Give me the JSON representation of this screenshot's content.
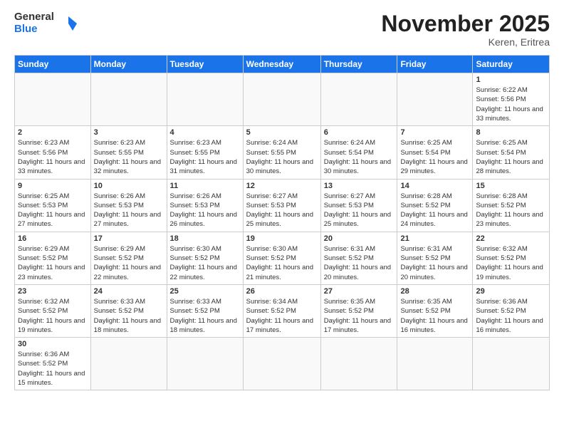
{
  "header": {
    "logo_general": "General",
    "logo_blue": "Blue",
    "month_title": "November 2025",
    "location": "Keren, Eritrea"
  },
  "days_of_week": [
    "Sunday",
    "Monday",
    "Tuesday",
    "Wednesday",
    "Thursday",
    "Friday",
    "Saturday"
  ],
  "weeks": [
    [
      {
        "day": "",
        "info": ""
      },
      {
        "day": "",
        "info": ""
      },
      {
        "day": "",
        "info": ""
      },
      {
        "day": "",
        "info": ""
      },
      {
        "day": "",
        "info": ""
      },
      {
        "day": "",
        "info": ""
      },
      {
        "day": "1",
        "info": "Sunrise: 6:22 AM\nSunset: 5:56 PM\nDaylight: 11 hours and 33 minutes."
      }
    ],
    [
      {
        "day": "2",
        "info": "Sunrise: 6:23 AM\nSunset: 5:56 PM\nDaylight: 11 hours and 33 minutes."
      },
      {
        "day": "3",
        "info": "Sunrise: 6:23 AM\nSunset: 5:55 PM\nDaylight: 11 hours and 32 minutes."
      },
      {
        "day": "4",
        "info": "Sunrise: 6:23 AM\nSunset: 5:55 PM\nDaylight: 11 hours and 31 minutes."
      },
      {
        "day": "5",
        "info": "Sunrise: 6:24 AM\nSunset: 5:55 PM\nDaylight: 11 hours and 30 minutes."
      },
      {
        "day": "6",
        "info": "Sunrise: 6:24 AM\nSunset: 5:54 PM\nDaylight: 11 hours and 30 minutes."
      },
      {
        "day": "7",
        "info": "Sunrise: 6:25 AM\nSunset: 5:54 PM\nDaylight: 11 hours and 29 minutes."
      },
      {
        "day": "8",
        "info": "Sunrise: 6:25 AM\nSunset: 5:54 PM\nDaylight: 11 hours and 28 minutes."
      }
    ],
    [
      {
        "day": "9",
        "info": "Sunrise: 6:25 AM\nSunset: 5:53 PM\nDaylight: 11 hours and 27 minutes."
      },
      {
        "day": "10",
        "info": "Sunrise: 6:26 AM\nSunset: 5:53 PM\nDaylight: 11 hours and 27 minutes."
      },
      {
        "day": "11",
        "info": "Sunrise: 6:26 AM\nSunset: 5:53 PM\nDaylight: 11 hours and 26 minutes."
      },
      {
        "day": "12",
        "info": "Sunrise: 6:27 AM\nSunset: 5:53 PM\nDaylight: 11 hours and 25 minutes."
      },
      {
        "day": "13",
        "info": "Sunrise: 6:27 AM\nSunset: 5:53 PM\nDaylight: 11 hours and 25 minutes."
      },
      {
        "day": "14",
        "info": "Sunrise: 6:28 AM\nSunset: 5:52 PM\nDaylight: 11 hours and 24 minutes."
      },
      {
        "day": "15",
        "info": "Sunrise: 6:28 AM\nSunset: 5:52 PM\nDaylight: 11 hours and 23 minutes."
      }
    ],
    [
      {
        "day": "16",
        "info": "Sunrise: 6:29 AM\nSunset: 5:52 PM\nDaylight: 11 hours and 23 minutes."
      },
      {
        "day": "17",
        "info": "Sunrise: 6:29 AM\nSunset: 5:52 PM\nDaylight: 11 hours and 22 minutes."
      },
      {
        "day": "18",
        "info": "Sunrise: 6:30 AM\nSunset: 5:52 PM\nDaylight: 11 hours and 22 minutes."
      },
      {
        "day": "19",
        "info": "Sunrise: 6:30 AM\nSunset: 5:52 PM\nDaylight: 11 hours and 21 minutes."
      },
      {
        "day": "20",
        "info": "Sunrise: 6:31 AM\nSunset: 5:52 PM\nDaylight: 11 hours and 20 minutes."
      },
      {
        "day": "21",
        "info": "Sunrise: 6:31 AM\nSunset: 5:52 PM\nDaylight: 11 hours and 20 minutes."
      },
      {
        "day": "22",
        "info": "Sunrise: 6:32 AM\nSunset: 5:52 PM\nDaylight: 11 hours and 19 minutes."
      }
    ],
    [
      {
        "day": "23",
        "info": "Sunrise: 6:32 AM\nSunset: 5:52 PM\nDaylight: 11 hours and 19 minutes."
      },
      {
        "day": "24",
        "info": "Sunrise: 6:33 AM\nSunset: 5:52 PM\nDaylight: 11 hours and 18 minutes."
      },
      {
        "day": "25",
        "info": "Sunrise: 6:33 AM\nSunset: 5:52 PM\nDaylight: 11 hours and 18 minutes."
      },
      {
        "day": "26",
        "info": "Sunrise: 6:34 AM\nSunset: 5:52 PM\nDaylight: 11 hours and 17 minutes."
      },
      {
        "day": "27",
        "info": "Sunrise: 6:35 AM\nSunset: 5:52 PM\nDaylight: 11 hours and 17 minutes."
      },
      {
        "day": "28",
        "info": "Sunrise: 6:35 AM\nSunset: 5:52 PM\nDaylight: 11 hours and 16 minutes."
      },
      {
        "day": "29",
        "info": "Sunrise: 6:36 AM\nSunset: 5:52 PM\nDaylight: 11 hours and 16 minutes."
      }
    ],
    [
      {
        "day": "30",
        "info": "Sunrise: 6:36 AM\nSunset: 5:52 PM\nDaylight: 11 hours and 15 minutes."
      },
      {
        "day": "",
        "info": ""
      },
      {
        "day": "",
        "info": ""
      },
      {
        "day": "",
        "info": ""
      },
      {
        "day": "",
        "info": ""
      },
      {
        "day": "",
        "info": ""
      },
      {
        "day": "",
        "info": ""
      }
    ]
  ]
}
